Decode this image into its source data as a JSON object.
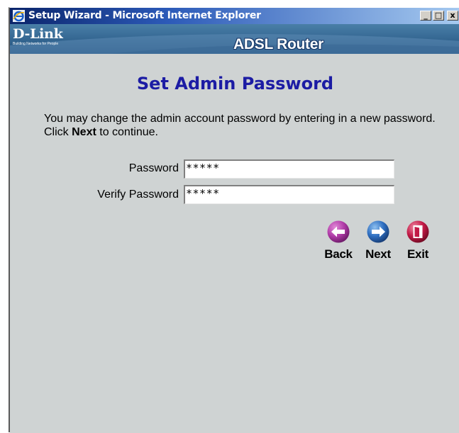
{
  "window": {
    "title": "Setup Wizard - Microsoft Internet Explorer",
    "minimize_glyph": "_",
    "maximize_glyph": "□",
    "close_glyph": "x"
  },
  "banner": {
    "brand": "D-Link",
    "tagline": "Building Networks for People",
    "product": "ADSL Router"
  },
  "page": {
    "heading": "Set Admin Password",
    "instructions_before": "You may change the admin account password by entering in a new password. Click ",
    "instructions_bold": "Next",
    "instructions_after": " to continue."
  },
  "form": {
    "password_label": "Password",
    "password_value": "*****",
    "verify_label": "Verify Password",
    "verify_value": "*****"
  },
  "buttons": {
    "back": "Back",
    "next": "Next",
    "exit": "Exit"
  },
  "colors": {
    "heading": "#1c1ca4",
    "back_button": "#b03ca8",
    "next_button": "#2e6ec0",
    "exit_button": "#c21a46",
    "title_bar": "#0a246a"
  }
}
